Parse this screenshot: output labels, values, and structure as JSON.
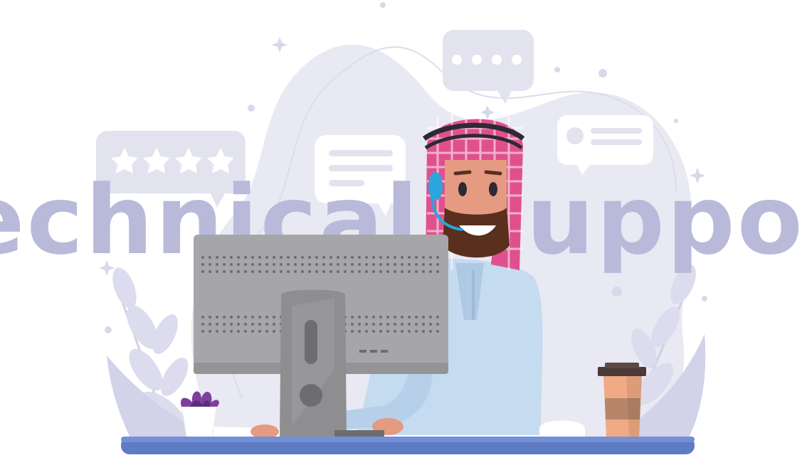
{
  "headline": "Technical Support",
  "colors": {
    "background": "#ffffff",
    "blob": "#e9e9f3",
    "headline": "#b9b9da",
    "monitor": "#a6a6a8",
    "thobe": "#c5dbef",
    "ghutra_pink": "#e0508e",
    "agal": "#2d2a35",
    "desk": "#5f7bc4",
    "headset": "#2aa6dd",
    "coffee_cup": "#f0aa84",
    "plant": "#7d3f9e"
  },
  "icons": {
    "rating_bubble": "star-rating-bubble-icon",
    "text_bubble": "text-message-bubble-icon",
    "typing_bubble": "typing-dots-bubble-icon",
    "profile_bubble": "profile-message-bubble-icon"
  },
  "rating": {
    "stars": 4
  }
}
